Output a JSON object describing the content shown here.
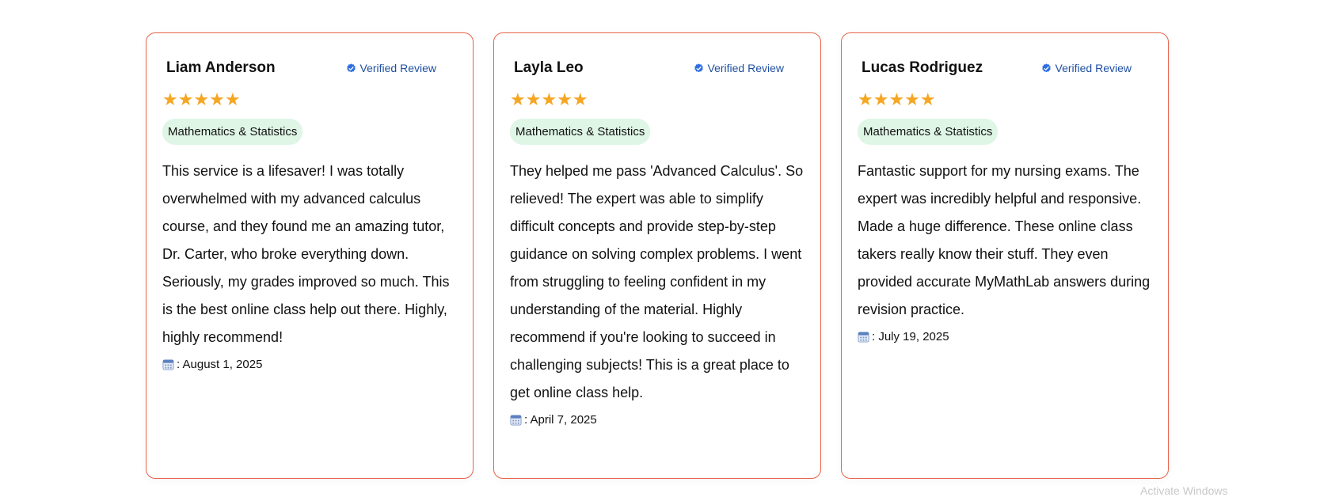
{
  "reviews": [
    {
      "name": "Liam Anderson",
      "verified_label": "Verified Review",
      "rating": 5,
      "stars": "★★★★★",
      "category": "Mathematics & Statistics",
      "text": "This service is a lifesaver! I was totally overwhelmed with my advanced calculus course, and they found me an amazing tutor, Dr. Carter, who broke everything down. Seriously, my grades improved so much. This is the best online class help out there. Highly, highly recommend!",
      "date": ": August 1, 2025"
    },
    {
      "name": "Layla Leo",
      "verified_label": "Verified Review",
      "rating": 5,
      "stars": "★★★★★",
      "category": "Mathematics & Statistics",
      "text": "They helped me pass 'Advanced Calculus'. So relieved! The expert was able to simplify difficult concepts and provide step-by-step guidance on solving complex problems. I went from struggling to feeling confident in my understanding of the material. Highly recommend if you're looking to succeed in challenging subjects! This is a great place to get online class help.",
      "date": ": April 7, 2025"
    },
    {
      "name": "Lucas Rodriguez",
      "verified_label": "Verified Review",
      "rating": 5,
      "stars": "★★★★★",
      "category": "Mathematics & Statistics",
      "text": "Fantastic support for my nursing exams. The expert was incredibly helpful and responsive. Made a huge difference. These online class takers really know their stuff. They even provided accurate MyMathLab answers during revision practice.",
      "date": ": July 19, 2025"
    }
  ],
  "icons": {
    "verified": "verified-check-icon",
    "star": "star-icon",
    "date": "calendar-icon"
  },
  "colors": {
    "card_border": "#e8644b",
    "star": "#f5a623",
    "verified": "#1f4fa3",
    "chip_background": "#dff6e6"
  },
  "edge_text": "Activate Windows"
}
